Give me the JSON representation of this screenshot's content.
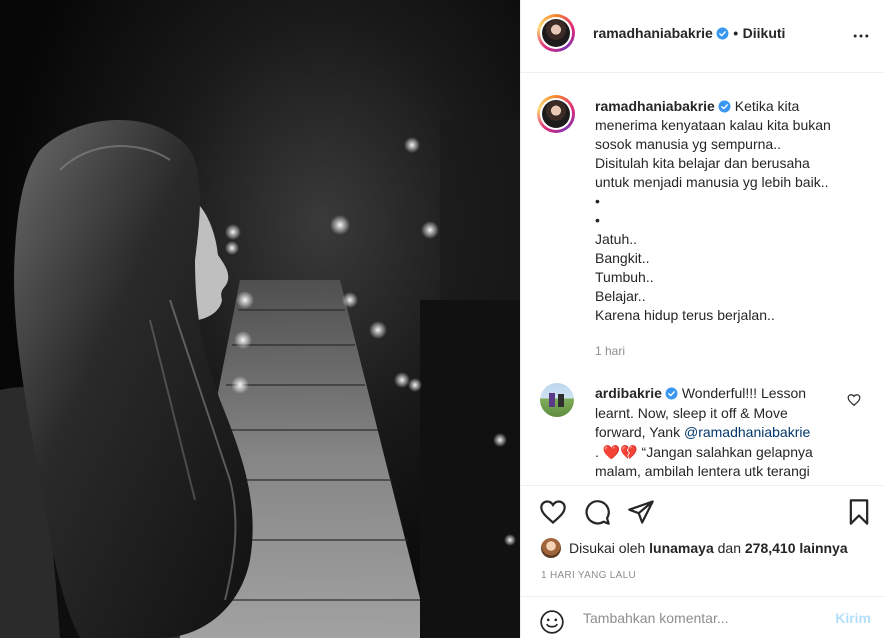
{
  "post": {
    "author": "ramadhaniabakrie",
    "follow_separator": "•",
    "follow_status": "Diikuti",
    "caption_lines": [
      "Ketika kita",
      "menerima kenyataan kalau kita bukan",
      "sosok manusia yg sempurna..",
      "Disitulah kita belajar dan berusaha",
      "untuk menjadi manusia yg lebih baik..",
      "•",
      "•",
      "Jatuh..",
      "Bangkit..",
      "Tumbuh..",
      "Belajar..",
      "Karena hidup terus berjalan.."
    ],
    "caption_time": "1 hari"
  },
  "comment": {
    "author": "ardibakrie",
    "line1": "Wonderful!!! Lesson",
    "line2": "learnt. Now, sleep it off & Move",
    "line3_prefix": "forward, Yank ",
    "mention": "@ramadhaniabakrie",
    "line4_prefix": ". ",
    "line4_emoji": "❤️💔",
    "line4_text": " “Jangan salahkan gelapnya",
    "line5": "malam, ambilah lentera utk terangi"
  },
  "likes": {
    "prefix": "Disukai oleh ",
    "user": "lunamaya",
    "middle": " dan ",
    "count": "278,410 lainnya"
  },
  "date": "1 HARI YANG LALU",
  "add_comment": {
    "placeholder": "Tambahkan komentar...",
    "post_label": "Kirim"
  },
  "icons": {
    "more": "more-horizontal-icon",
    "like": "heart-icon",
    "comment": "comment-bubble-icon",
    "share": "paper-plane-icon",
    "save": "bookmark-icon",
    "emoji": "emoji-smile-icon",
    "verified": "verified-badge-icon"
  },
  "colors": {
    "verified": "#3897f0",
    "mention": "#00376b",
    "post_disabled": "#b2dffc",
    "muted": "#8e8e8e"
  }
}
